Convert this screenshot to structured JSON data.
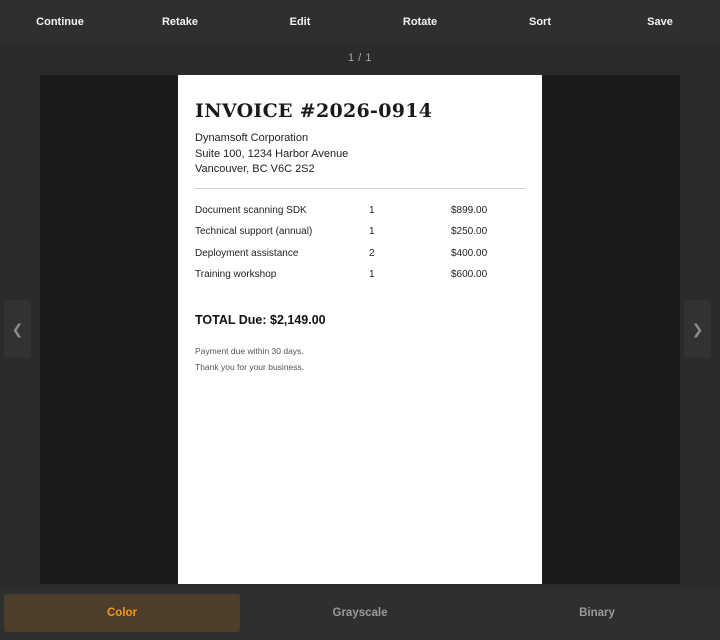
{
  "toolbar": {
    "continue_label": "Continue",
    "retake_label": "Retake",
    "edit_label": "Edit",
    "rotate_label": "Rotate",
    "sort_label": "Sort",
    "save_label": "Save"
  },
  "page_counter": "1 / 1",
  "document": {
    "title": "INVOICE #2026-0914",
    "address": [
      "Dynamsoft Corporation",
      "Suite 100, 1234 Harbor Avenue",
      "Vancouver, BC V6C 2S2"
    ],
    "items": [
      {
        "description": "Document scanning SDK",
        "qty": "1",
        "price": "$899.00"
      },
      {
        "description": "Technical support (annual)",
        "qty": "1",
        "price": "$250.00"
      },
      {
        "description": "Deployment assistance",
        "qty": "2",
        "price": "$400.00"
      },
      {
        "description": "Training workshop",
        "qty": "1",
        "price": "$600.00"
      }
    ],
    "total": "TOTAL Due: $2,149.00",
    "notes": [
      "Payment due within 30 days.",
      "Thank you for your business."
    ]
  },
  "nav": {
    "prev_icon": "chevron-left-icon",
    "next_icon": "chevron-right-icon",
    "prev_glyph": "❮",
    "next_glyph": "❯"
  },
  "filters": {
    "color_label": "Color",
    "grayscale_label": "Grayscale",
    "binary_label": "Binary",
    "selected": "Color"
  },
  "colors": {
    "accent": "#f39a1e",
    "selected_bg": "#4d3d2b",
    "toolbar_bg": "#2f2f2f",
    "viewer_bg": "#1b1b1b"
  }
}
